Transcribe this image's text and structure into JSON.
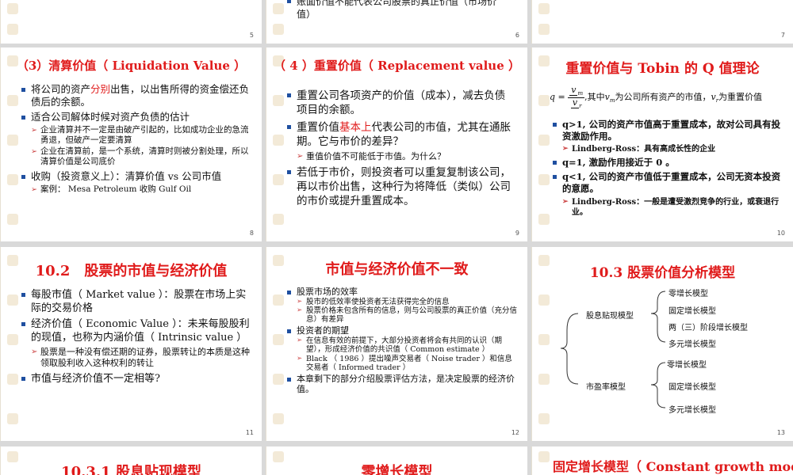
{
  "slides": {
    "s5": {
      "num": "5"
    },
    "s6": {
      "num": "6",
      "partial_text": "账面价值不能代表公司股票的真正价值（市场价值）",
      "line1": "账面价值不能代表公司股票的真正价",
      "line1b": "值（市场价",
      "line2": "值）"
    },
    "s7": {
      "num": "7"
    },
    "s8": {
      "num": "8",
      "title": "（3）清算价值（ Liquidation Value ）",
      "b1_pre": "将公司的资产",
      "b1_red": "分别",
      "b1_post": "出售，以出售所得的资金偿还负债后的余额。",
      "b2": "适合公司解体时候对资产负债的估计",
      "b2_s1": "企业清算并不一定是由破产引起的，比如成功企业的急流勇退，但破产一定要清算",
      "b2_s2": "企业在清算前，是一个系统，清算时则被分割处理，所以清算价值是公司底价",
      "b3": "收购（投资意义上）：清算价值 vs 公司市值",
      "b3_s1": "案例： Mesa Petroleum 收购 Gulf Oil"
    },
    "s9": {
      "num": "9",
      "title": "（ 4 ）重置价值（ Replacement value ）",
      "b1": "重置公司各项资产的价值（成本），减去负债项目的余额。",
      "b2_pre": "重置价值",
      "b2_red": "基本上",
      "b2_post": "代表公司的市值，尤其在通胀期。它与市价的差异？",
      "b2_s1": "重值价值不可能低于市值。为什么？",
      "b3": "若低于市价，则投资者可以重复复制该公司，再以市价出售，这种行为将降低（类似）公司的市价或提升重置成本。"
    },
    "s10": {
      "num": "10",
      "title": "重置价值与 Tobin 的 Q 值理论",
      "q": "q",
      "eq": "=",
      "vm": "v",
      "vm_sub": "m",
      "vr": "v",
      "vr_sub": "r",
      "formula_text1": ",其中",
      "formula_text2": "为公司所有资产的市值，",
      "formula_text3": "为重置价值",
      "b1": "q>1, 公司的资产市值高于重置成本，故对公司具有投资激励作用。",
      "b1_s1": "Lindberg-Ross：具有高成长性的企业",
      "b2": "q=1, 激励作用接近于 0 。",
      "b3": "q<1, 公司的资产市值低于重置成本，公司无资本投资的意愿。",
      "b3_s1": "Lindberg-Ross：一般是遭受激烈竞争的行业，或衰退行业。"
    },
    "s11": {
      "num": "11",
      "title": "10.2　股票的市值与经济价值",
      "b1": "每股市值（ Market value ）：股票在市场上实际的交易价格",
      "b2": "经济价值（ Economic Value ）：未来每股股利的现值，也称为内涵价值（ Intrinsic value ）",
      "b2_s1": "股票是一种没有偿还期的证券，股票转让的本质是这种领取股利收入这种权利的转让",
      "b3": "市值与经济价值不一定相等?"
    },
    "s12": {
      "num": "12",
      "title": "市值与经济价值不一致",
      "b1": "股票市场的效率",
      "b1_s1": "股市的低效率使投资者无法获得完全的信息",
      "b1_s2": "股票价格未包含所有的信息，则与公司股票的真正价值（充分信息）有差异",
      "b2": "投资者的期望",
      "b2_s1": "在信息有效的前提下，大部分投资者将会有共同的认识（期望），形成经济价值的共识值（ Common estimate ）",
      "b2_s2": "Black （ 1986 ）提出噪声交易者（ Noise trader ）和信息交易者（ Informed trader ）",
      "b3": "本章剩下的部分介绍股票评估方法，是决定股票的经济价值。"
    },
    "s13": {
      "num": "13",
      "title": "10.3  股票价值分析模型",
      "g1": "股息贴现模型",
      "g1_items": [
        "零增长模型",
        "固定增长模型",
        "两（三）阶段增长模型",
        "多元增长模型"
      ],
      "g2": "市盈率模型",
      "g2_items": [
        "零增长模型",
        "固定增长模型",
        "多元增长模型"
      ]
    },
    "s14": {
      "title": "10.3.1  股息贴现模型"
    },
    "s15": {
      "title": "零增长模型"
    },
    "s16": {
      "title": "固定增长模型（ Constant growth mode"
    }
  }
}
